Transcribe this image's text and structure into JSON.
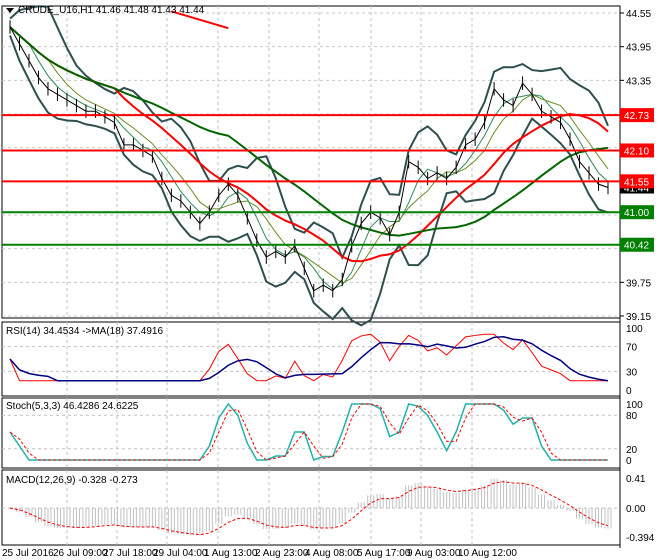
{
  "header": {
    "symbol_line": "CRUDE_U16,H1  41.46 41.48 41.43 41.44"
  },
  "chart_data": {
    "type": "line",
    "main": {
      "price_ticks": [
        "44.55",
        "43.95",
        "43.35",
        "39.75",
        "39.15"
      ],
      "ylim": [
        39.15,
        44.55
      ],
      "current_price": "41.44",
      "close": [
        44.3,
        44.0,
        43.7,
        43.4,
        43.2,
        43.1,
        43.0,
        42.9,
        42.8,
        42.8,
        42.7,
        42.6,
        42.2,
        42.2,
        42.1,
        42.0,
        41.6,
        41.3,
        41.2,
        41.0,
        40.8,
        41.0,
        41.3,
        41.5,
        41.3,
        40.9,
        40.5,
        40.2,
        40.3,
        40.2,
        40.4,
        40.0,
        39.6,
        39.7,
        39.6,
        39.8,
        40.4,
        40.8,
        41.0,
        40.9,
        40.6,
        41.0,
        41.9,
        41.8,
        41.6,
        41.7,
        41.6,
        41.8,
        42.2,
        42.3,
        42.6,
        43.2,
        43.0,
        42.9,
        43.3,
        43.1,
        42.8,
        42.7,
        42.6,
        42.3,
        41.9,
        41.7,
        41.5,
        41.44
      ],
      "levels": [
        {
          "value": "42.73",
          "color": "#ff0000"
        },
        {
          "value": "42.10",
          "color": "#ff0000"
        },
        {
          "value": "41.55",
          "color": "#ff0000"
        },
        {
          "value": "41.00",
          "color": "#008000"
        },
        {
          "value": "40.42",
          "color": "#008000"
        }
      ],
      "trendline": {
        "from": [
          17,
          44.58
        ],
        "to": [
          23,
          44.28
        ],
        "color": "#ff0000"
      }
    },
    "rsi": {
      "label": "RSI(14) 34.4534  ->MA(18) 37.4916",
      "ticks": [
        "100",
        "70",
        "30",
        "0"
      ]
    },
    "stoch": {
      "label": "Stoch(5,3,3) 46.4286 24.6225",
      "ticks": [
        "100",
        "80",
        "20",
        "0"
      ]
    },
    "macd": {
      "label": "MACD(12,26,9) -0.328 -0.273",
      "ticks": [
        "0.41",
        "0.00",
        "-0.394"
      ]
    },
    "x_ticks": [
      "25 Jul 2016",
      "26 Jul 09:00",
      "27 Jul 18:00",
      "29 Jul 04:00",
      "1 Aug 13:00",
      "2 Aug 23:00",
      "4 Aug 08:00",
      "5 Aug 17:00",
      "9 Aug 03:00",
      "10 Aug 12:00"
    ],
    "colors": {
      "price": "#000000",
      "ma_fast": "#ff0000",
      "ma_slow": "#006400",
      "bands": "#2f4f4f",
      "rsi": "#ff0000",
      "rsi_ma": "#000080",
      "stoch_main": "#20b2aa",
      "stoch_signal": "#ff0000",
      "macd_hist": "#c0c0c0",
      "macd_signal": "#ff0000"
    }
  }
}
